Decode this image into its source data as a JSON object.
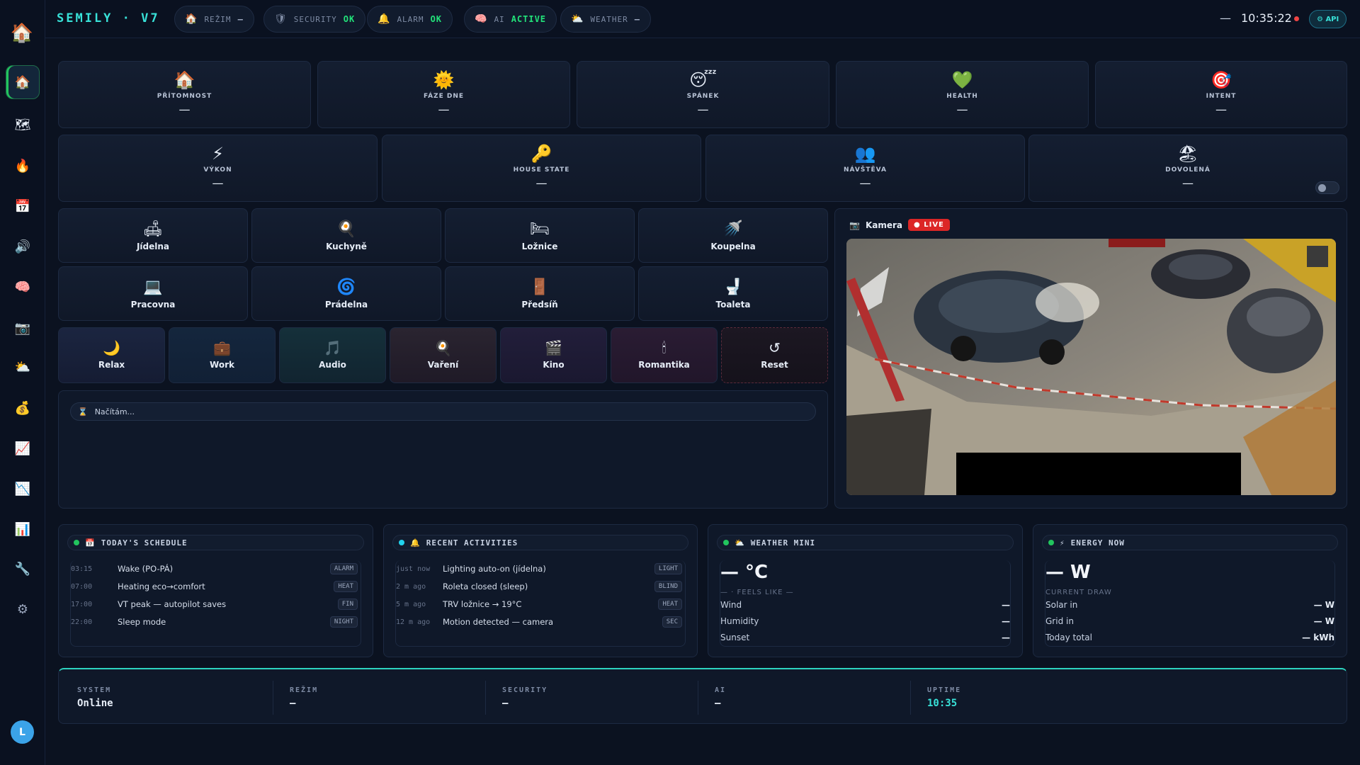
{
  "topbar": {
    "brand": "SEMILY · V7",
    "pills": [
      {
        "icon": "home-icon",
        "label": "REŽIM",
        "value": "—"
      },
      {
        "icon": "shield-icon",
        "label": "SECURITY",
        "value": "OK"
      },
      {
        "icon": "bell-icon",
        "label": "ALARM",
        "value": "OK"
      },
      {
        "icon": "brain-icon",
        "label": "AI",
        "value": "ACTIVE"
      },
      {
        "icon": "cloud-icon",
        "label": "WEATHER",
        "value": "—"
      }
    ],
    "dash": "—",
    "clock": "10:35:22",
    "api_label": "⚙ API"
  },
  "sidebar": {
    "items": [
      "home-icon",
      "map-icon",
      "fire-icon",
      "calendar-icon",
      "speaker-icon",
      "brain-icon",
      "camera-icon",
      "cloud-icon",
      "money-bag-icon",
      "chart-up-icon",
      "chart-down-icon",
      "bar-chart-icon",
      "wrench-icon",
      "settings-icon"
    ],
    "avatar": "L"
  },
  "status_tiles_row1": [
    {
      "emoji": "🏠",
      "label": "PŘÍTOMNOST",
      "value": "—"
    },
    {
      "emoji": "🌞",
      "label": "FÁZE DNE",
      "value": "—"
    },
    {
      "emoji": "😴",
      "label": "SPÁNEK",
      "value": "—"
    },
    {
      "emoji": "💚",
      "label": "HEALTH",
      "value": "—"
    },
    {
      "emoji": "🎯",
      "label": "INTENT",
      "value": "—"
    }
  ],
  "status_tiles_row2": [
    {
      "emoji": "⚡",
      "label": "VÝKON",
      "value": "—"
    },
    {
      "emoji": "🔑",
      "label": "HOUSE STATE",
      "value": "—"
    },
    {
      "emoji": "👥",
      "label": "NÁVŠTĚVA",
      "value": "—"
    },
    {
      "emoji": "🏖",
      "label": "DOVOLENÁ",
      "value": "—"
    }
  ],
  "rooms": [
    {
      "emoji": "🛋",
      "name": "Jídelna"
    },
    {
      "emoji": "🍳",
      "name": "Kuchyně"
    },
    {
      "emoji": "🛏",
      "name": "Ložnice"
    },
    {
      "emoji": "🚿",
      "name": "Koupelna"
    },
    {
      "emoji": "💻",
      "name": "Pracovna"
    },
    {
      "emoji": "🌀",
      "name": "Prádelna"
    },
    {
      "emoji": "🚪",
      "name": "Předsíň"
    },
    {
      "emoji": "🚽",
      "name": "Toaleta"
    }
  ],
  "scenes": [
    {
      "emoji": "🌙",
      "name": "Relax"
    },
    {
      "emoji": "💼",
      "name": "Work"
    },
    {
      "emoji": "🎵",
      "name": "Audio"
    },
    {
      "emoji": "🍳",
      "name": "Vaření"
    },
    {
      "emoji": "🎬",
      "name": "Kino"
    },
    {
      "emoji": "🕯",
      "name": "Romantika"
    },
    {
      "emoji": "↺",
      "name": "Reset"
    }
  ],
  "loader": {
    "icon": "⌛",
    "text": "Načítám..."
  },
  "camera": {
    "icon": "📷",
    "title": "Kamera",
    "live": "● LIVE"
  },
  "schedule": {
    "title": "TODAY'S SCHEDULE",
    "rows": [
      {
        "time": "03:15",
        "desc": "Wake (PO-PÁ)",
        "tag": "ALARM"
      },
      {
        "time": "07:00",
        "desc": "Heating eco→comfort",
        "tag": "HEAT"
      },
      {
        "time": "17:00",
        "desc": "VT peak — autopilot saves",
        "tag": "FIN"
      },
      {
        "time": "22:00",
        "desc": "Sleep mode",
        "tag": "NIGHT"
      }
    ]
  },
  "activities": {
    "title": "RECENT ACTIVITIES",
    "rows": [
      {
        "time": "just now",
        "desc": "Lighting auto-on (jídelna)",
        "tag": "LIGHT"
      },
      {
        "time": "2 m ago",
        "desc": "Roleta closed (sleep)",
        "tag": "BLIND"
      },
      {
        "time": "5 m ago",
        "desc": "TRV ložnice → 19°C",
        "tag": "HEAT"
      },
      {
        "time": "12 m ago",
        "desc": "Motion detected — camera",
        "tag": "SEC"
      }
    ]
  },
  "weather": {
    "title": "WEATHER MINI",
    "temp": "— °C",
    "feels": "— · FEELS LIKE —",
    "rows": [
      {
        "k": "Wind",
        "v": "—"
      },
      {
        "k": "Humidity",
        "v": "—"
      },
      {
        "k": "Sunset",
        "v": "—"
      }
    ]
  },
  "energy": {
    "title": "ENERGY NOW",
    "power": "— W",
    "caption": "CURRENT DRAW",
    "rows": [
      {
        "k": "Solar in",
        "v": "— W"
      },
      {
        "k": "Grid in",
        "v": "— W"
      },
      {
        "k": "Today total",
        "v": "— kWh"
      }
    ]
  },
  "statusbar": [
    {
      "k": "SYSTEM",
      "v": "Online"
    },
    {
      "k": "REŽIM",
      "v": "—"
    },
    {
      "k": "SECURITY",
      "v": "—"
    },
    {
      "k": "AI",
      "v": "—"
    },
    {
      "k": "UPTIME",
      "v": "10:35"
    }
  ],
  "colors": {
    "accent": "#38e1d8",
    "ok": "#22e37a",
    "live": "#dc2626",
    "bg": "#0b1220"
  }
}
